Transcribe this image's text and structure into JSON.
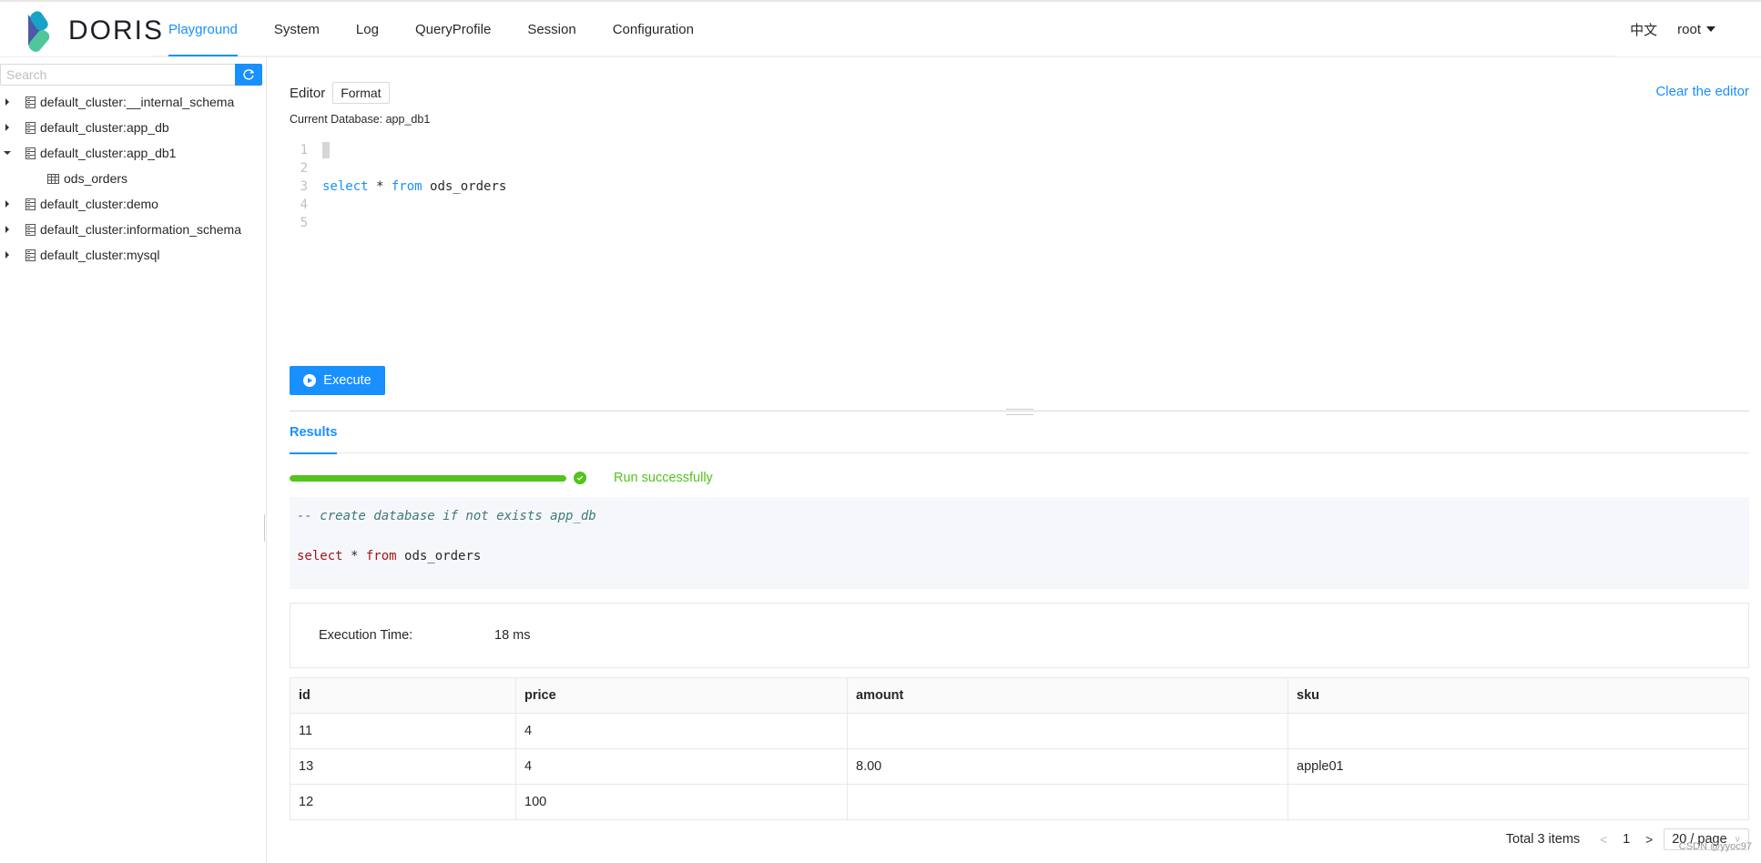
{
  "app": {
    "brand": "DORIS",
    "colors": {
      "accent": "#1890ff",
      "success": "#52c41a"
    }
  },
  "nav": {
    "items": [
      {
        "label": "Playground",
        "active": true
      },
      {
        "label": "System"
      },
      {
        "label": "Log"
      },
      {
        "label": "QueryProfile"
      },
      {
        "label": "Session"
      },
      {
        "label": "Configuration"
      }
    ],
    "language": "中文",
    "user": "root"
  },
  "sidebar": {
    "search_placeholder": "Search",
    "refresh_icon": "reload-icon",
    "tree": [
      {
        "label": "default_cluster:__internal_schema",
        "expanded": false,
        "icon": "database-icon"
      },
      {
        "label": "default_cluster:app_db",
        "expanded": false,
        "icon": "database-icon"
      },
      {
        "label": "default_cluster:app_db1",
        "expanded": true,
        "icon": "database-icon"
      },
      {
        "label": "ods_orders",
        "leaf": true,
        "icon": "table-icon"
      },
      {
        "label": "default_cluster:demo",
        "expanded": false,
        "icon": "database-icon"
      },
      {
        "label": "default_cluster:information_schema",
        "expanded": false,
        "icon": "database-icon"
      },
      {
        "label": "default_cluster:mysql",
        "expanded": false,
        "icon": "database-icon"
      }
    ]
  },
  "editor": {
    "title": "Editor",
    "format_label": "Format",
    "clear_label": "Clear the editor",
    "current_database": "Current Database: app_db1",
    "lines": [
      {
        "no": "1",
        "tokens": []
      },
      {
        "no": "2",
        "tokens": []
      },
      {
        "no": "3",
        "tokens": [
          {
            "text": "select",
            "kw": true
          },
          {
            "text": " * ",
            "kw": false
          },
          {
            "text": "from",
            "kw": true
          },
          {
            "text": " ods_orders",
            "kw": false
          }
        ]
      },
      {
        "no": "4",
        "tokens": []
      },
      {
        "no": "5",
        "tokens": []
      }
    ],
    "execute_label": "Execute"
  },
  "results": {
    "tab_label": "Results",
    "progress_percent": 100,
    "status": "Run successfully",
    "sql_comment": "-- create database if not exists app_db",
    "sql_tokens": [
      {
        "text": "select",
        "kw": true
      },
      {
        "text": " * ",
        "kw": false
      },
      {
        "text": "from",
        "kw": true
      },
      {
        "text": " ods_orders",
        "kw": false
      }
    ],
    "execution_time_label": "Execution Time:",
    "execution_time_value": "18 ms",
    "table": {
      "columns": [
        "id",
        "price",
        "amount",
        "sku"
      ],
      "rows": [
        [
          "11",
          "4",
          "",
          ""
        ],
        [
          "13",
          "4",
          "8.00",
          "apple01"
        ],
        [
          "12",
          "100",
          "",
          ""
        ]
      ]
    },
    "pagination": {
      "total_label": "Total 3 items",
      "current_page": "1",
      "page_size": "20 / page"
    }
  },
  "watermark": "CSDN @yyoc97"
}
